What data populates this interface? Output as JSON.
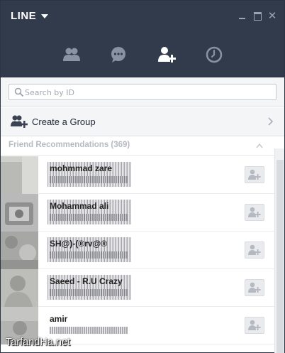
{
  "app": {
    "title": "LINE"
  },
  "nav": {
    "tabs": [
      {
        "icon": "friends-icon",
        "active": false
      },
      {
        "icon": "chat-icon",
        "active": false
      },
      {
        "icon": "add-friend-icon",
        "active": true
      },
      {
        "icon": "history-clock-icon",
        "active": false
      }
    ]
  },
  "search": {
    "placeholder": "Search by ID",
    "value": ""
  },
  "create_group": {
    "label": "Create a Group",
    "icon": "create-group-icon"
  },
  "recommendations": {
    "header": "Friend Recommendations (369)",
    "items": [
      {
        "name": "mohmmad zare"
      },
      {
        "name": "Mohammad ali"
      },
      {
        "name": "SH@)-(®rv@®"
      },
      {
        "name": "Saeed - R.U Crazy"
      },
      {
        "name": "amir"
      }
    ]
  },
  "watermark": "TarfandHa.net",
  "colors": {
    "header_bg": "#323b4c",
    "active_icon": "#ffffff",
    "inactive_icon": "#8a93a4",
    "panel_bg": "#f4f5f7"
  }
}
